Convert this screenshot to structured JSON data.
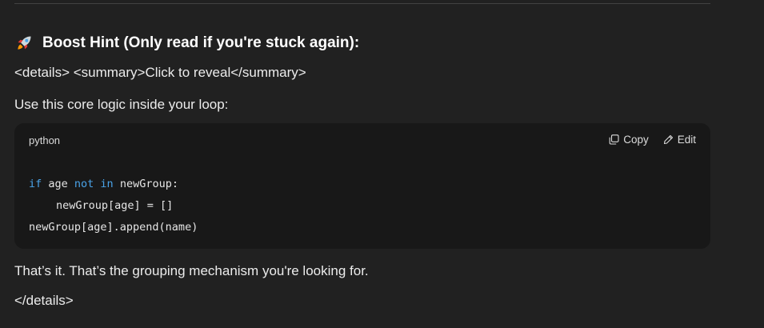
{
  "heading": {
    "icon": "rocket-icon",
    "text": "Boost Hint (Only read if you're stuck again):"
  },
  "paragraphs": {
    "details_open": "<details> <summary>Click to reveal</summary>",
    "intro": "Use this core logic inside your loop:",
    "outro": "That’s it. That’s the grouping mechanism you're looking for.",
    "details_close": "</details>"
  },
  "code_block": {
    "language": "python",
    "copy_label": "Copy",
    "edit_label": "Edit",
    "lines": [
      {
        "kw1": "if",
        "t1": " age ",
        "kw2": "not in",
        "t2": " newGroup:"
      },
      {
        "text": "newGroup[age] = []"
      },
      {
        "text": "newGroup[age].append(name)"
      }
    ]
  },
  "colors": {
    "background": "#212121",
    "code_background": "#181818",
    "keyword": "#4aa3e8",
    "text": "#ececec"
  }
}
